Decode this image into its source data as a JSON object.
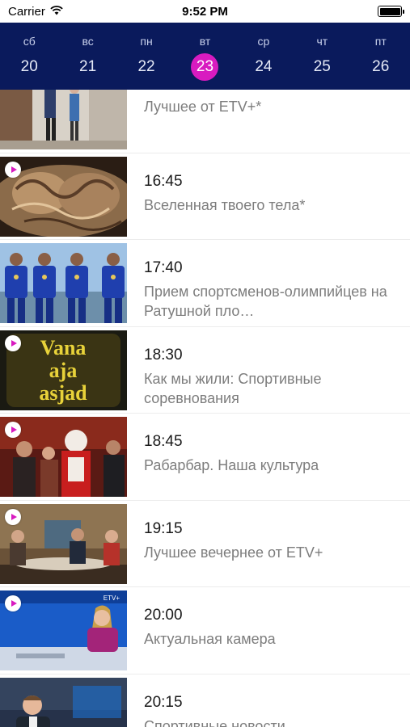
{
  "status_bar": {
    "carrier": "Carrier",
    "time": "9:52 PM",
    "battery_level": 1.0
  },
  "days": [
    {
      "name": "сб",
      "num": "20",
      "selected": false
    },
    {
      "name": "вс",
      "num": "21",
      "selected": false
    },
    {
      "name": "пн",
      "num": "22",
      "selected": false
    },
    {
      "name": "вт",
      "num": "23",
      "selected": true
    },
    {
      "name": "ср",
      "num": "24",
      "selected": false
    },
    {
      "name": "чт",
      "num": "25",
      "selected": false
    },
    {
      "name": "пт",
      "num": "26",
      "selected": false
    }
  ],
  "colors": {
    "header_bg": "#0a1a5c",
    "accent": "#d81bc0",
    "time_text": "#1a1a1a",
    "title_text": "#7d7d7d"
  },
  "programs": [
    {
      "time": "",
      "title": "Лучшее от ETV+*",
      "has_play": false,
      "thumb": "studio-people"
    },
    {
      "time": "16:45",
      "title": "Вселенная твоего тела*",
      "has_play": true,
      "thumb": "macro-organism"
    },
    {
      "time": "17:40",
      "title": "Прием спортсменов-олимпийцев на Ратушной пло…",
      "has_play": false,
      "thumb": "athletes-blue"
    },
    {
      "time": "18:30",
      "title": "Как мы жили: Спортивные соревнования",
      "has_play": true,
      "thumb": "vana-aja-asjad"
    },
    {
      "time": "18:45",
      "title": "Рабарбар. Наша культура",
      "has_play": true,
      "thumb": "santa-party"
    },
    {
      "time": "19:15",
      "title": "Лучшее вечернее от ETV+",
      "has_play": true,
      "thumb": "studio-talk"
    },
    {
      "time": "20:00",
      "title": "Актуальная камера",
      "has_play": true,
      "thumb": "news-anchor"
    },
    {
      "time": "20:15",
      "title": "Спортивные новости",
      "has_play": false,
      "thumb": "sports-presenter"
    }
  ],
  "thumb_text": {
    "vana_line1": "Vana",
    "vana_line2": "aja",
    "vana_line3": "asjad",
    "etv_logo": "ETV+"
  }
}
